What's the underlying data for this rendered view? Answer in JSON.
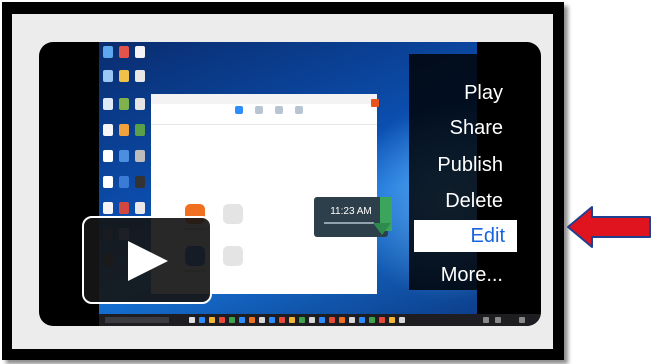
{
  "menu": {
    "items": [
      {
        "label": "Play"
      },
      {
        "label": "Share"
      },
      {
        "label": "Publish"
      },
      {
        "label": "Delete"
      },
      {
        "label": "Edit",
        "selected": true
      },
      {
        "label": "More..."
      }
    ]
  },
  "thumbnail": {
    "clock_time": "11:23 AM"
  },
  "colors": {
    "selected_text": "#1a63e0",
    "arrow_fill": "#e0141e",
    "arrow_outline": "#1f3f8f"
  },
  "icons": [
    "play-icon",
    "red-arrow-icon"
  ]
}
